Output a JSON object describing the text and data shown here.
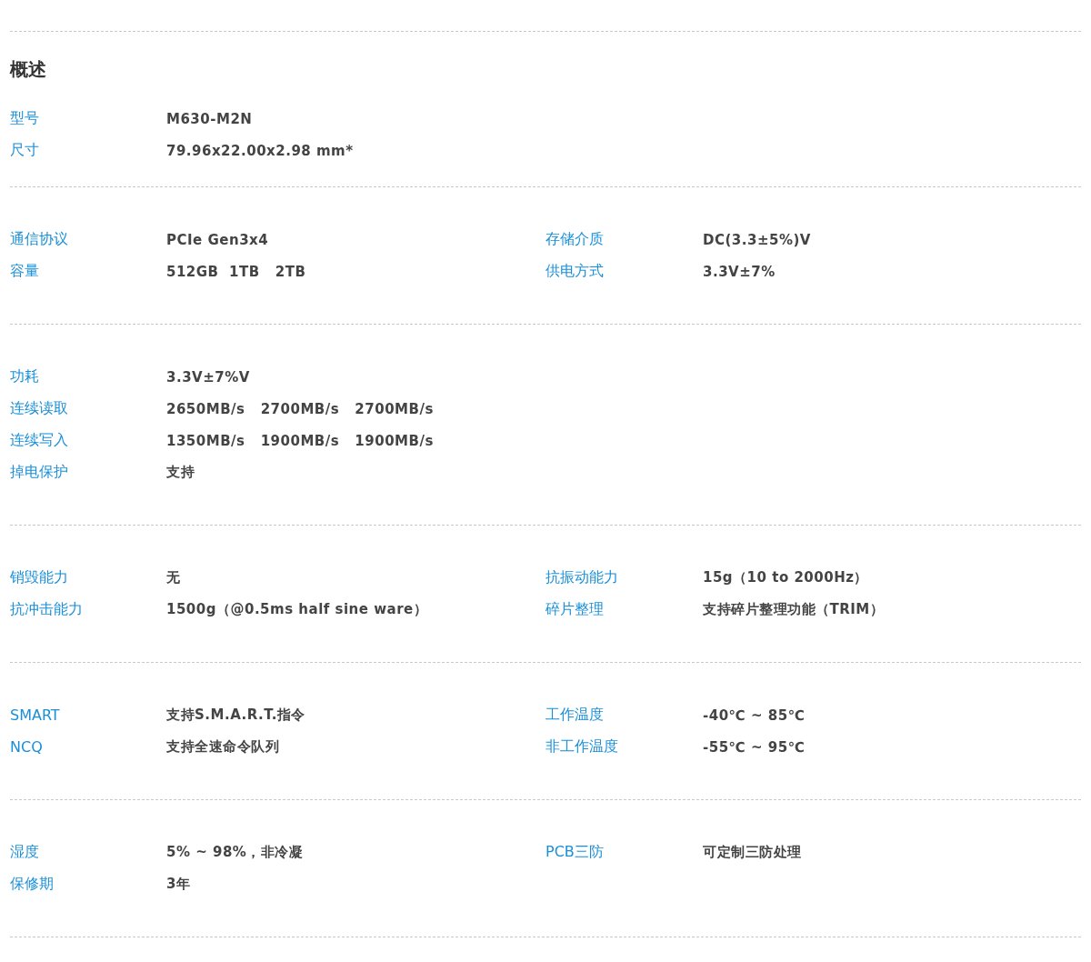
{
  "sections": [
    {
      "title": "概述",
      "left": [
        {
          "label": "型号",
          "value": "M630-M2N"
        },
        {
          "label": "尺寸",
          "value": "79.96x22.00x2.98 mm*"
        }
      ]
    },
    {
      "left": [
        {
          "label": "通信协议",
          "value": "PCIe Gen3x4"
        },
        {
          "label": "容量",
          "value": "512GB  1TB   2TB"
        }
      ],
      "right": [
        {
          "label": "存储介质",
          "value": "DC(3.3±5%)V"
        },
        {
          "label": "供电方式",
          "value": "3.3V±7%"
        }
      ]
    },
    {
      "left": [
        {
          "label": "功耗",
          "value": "3.3V±7%V"
        },
        {
          "label": "连续读取",
          "value": "2650MB/s   2700MB/s   2700MB/s"
        },
        {
          "label": "连续写入",
          "value": "1350MB/s   1900MB/s   1900MB/s"
        },
        {
          "label": "掉电保护",
          "value": "支持"
        }
      ]
    },
    {
      "left": [
        {
          "label": "销毁能力",
          "value": "无"
        },
        {
          "label": "抗冲击能力",
          "value": "1500g（@0.5ms half sine ware）"
        }
      ],
      "right": [
        {
          "label": "抗振动能力",
          "value": "15g（10 to 2000Hz）"
        },
        {
          "label": "碎片整理",
          "value": "支持碎片整理功能（TRIM）"
        }
      ]
    },
    {
      "left": [
        {
          "label": "SMART",
          "value": "支持S.M.A.R.T.指令"
        },
        {
          "label": "NCQ",
          "value": "支持全速命令队列"
        }
      ],
      "right": [
        {
          "label": "工作温度",
          "value": "-40℃ ~ 85℃"
        },
        {
          "label": "非工作温度",
          "value": "-55℃ ~ 95℃"
        }
      ]
    },
    {
      "left": [
        {
          "label": "湿度",
          "value": "5% ~ 98%，非冷凝"
        },
        {
          "label": "保修期",
          "value": "3年"
        }
      ],
      "right": [
        {
          "label": "PCB三防",
          "value": "可定制三防处理"
        }
      ]
    }
  ]
}
